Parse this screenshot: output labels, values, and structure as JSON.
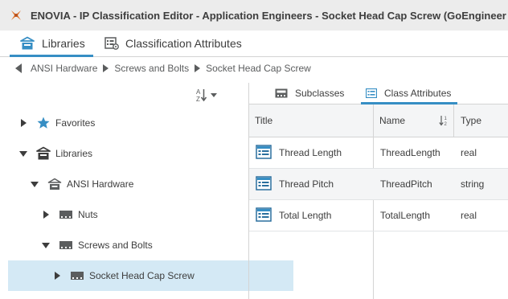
{
  "window": {
    "title": "ENOVIA - IP Classification Editor - Application Engineers - Socket Head Cap Screw (GoEngineer",
    "logo_icon": "3ds-compass-logo"
  },
  "tabs": [
    {
      "label": "Libraries",
      "icon": "libraries-icon",
      "active": true
    },
    {
      "label": "Classification Attributes",
      "icon": "classification-attributes-icon",
      "active": false
    }
  ],
  "breadcrumb": {
    "back_icon": "triangle-left-icon",
    "items": [
      "ANSI Hardware",
      "Screws and Bolts",
      "Socket Head Cap Screw"
    ]
  },
  "tree": {
    "sort_icon": "sort-az-icon",
    "nodes": [
      {
        "label": "Favorites",
        "icon": "star-icon",
        "expanded": false
      },
      {
        "label": "Libraries",
        "icon": "libraries-icon",
        "expanded": true
      },
      {
        "label": "ANSI Hardware",
        "icon": "library-icon",
        "expanded": true
      },
      {
        "label": "Nuts",
        "icon": "class-icon",
        "expanded": false
      },
      {
        "label": "Screws and Bolts",
        "icon": "class-icon",
        "expanded": true
      },
      {
        "label": "Socket Head Cap Screw",
        "icon": "class-icon",
        "expanded": false,
        "selected": true
      }
    ]
  },
  "subtabs": [
    {
      "label": "Subclasses",
      "icon": "subclasses-icon",
      "active": false
    },
    {
      "label": "Class Attributes",
      "icon": "class-attributes-icon",
      "active": true
    }
  ],
  "grid": {
    "columns": [
      "Title",
      "Name",
      "Type"
    ],
    "sort_icon": "sort-indicator-icon",
    "rows": [
      {
        "title": "Thread Length",
        "name": "ThreadLength",
        "type": "real"
      },
      {
        "title": "Thread Pitch",
        "name": "ThreadPitch",
        "type": "string"
      },
      {
        "title": "Total Length",
        "name": "TotalLength",
        "type": "real"
      }
    ]
  },
  "colors": {
    "accent": "#368ec4",
    "selected_row": "#d4e9f5",
    "brand_logo": "#e0742c"
  }
}
